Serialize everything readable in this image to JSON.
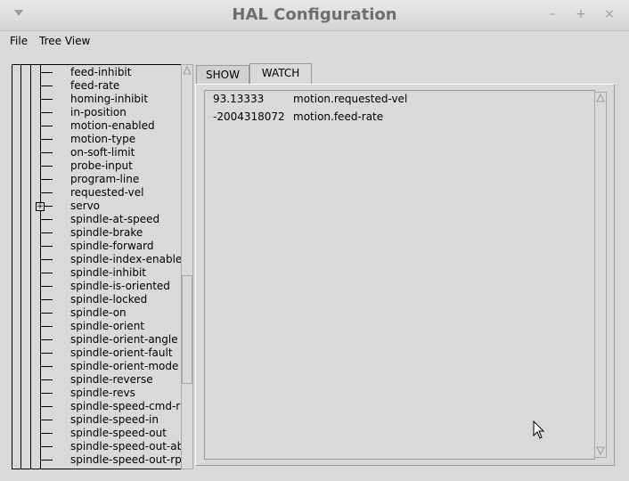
{
  "window": {
    "title": "HAL Configuration",
    "controls": {
      "minimize": "–",
      "maximize": "+",
      "close": "×"
    }
  },
  "menubar": {
    "items": [
      {
        "label": "File"
      },
      {
        "label": "Tree View"
      }
    ]
  },
  "tree": {
    "items": [
      {
        "label": "feed-inhibit",
        "expandable": false
      },
      {
        "label": "feed-rate",
        "expandable": false
      },
      {
        "label": "homing-inhibit",
        "expandable": false
      },
      {
        "label": "in-position",
        "expandable": false
      },
      {
        "label": "motion-enabled",
        "expandable": false
      },
      {
        "label": "motion-type",
        "expandable": false
      },
      {
        "label": "on-soft-limit",
        "expandable": false
      },
      {
        "label": "probe-input",
        "expandable": false
      },
      {
        "label": "program-line",
        "expandable": false
      },
      {
        "label": "requested-vel",
        "expandable": false
      },
      {
        "label": "servo",
        "expandable": true
      },
      {
        "label": "spindle-at-speed",
        "expandable": false
      },
      {
        "label": "spindle-brake",
        "expandable": false
      },
      {
        "label": "spindle-forward",
        "expandable": false
      },
      {
        "label": "spindle-index-enable",
        "expandable": false
      },
      {
        "label": "spindle-inhibit",
        "expandable": false
      },
      {
        "label": "spindle-is-oriented",
        "expandable": false
      },
      {
        "label": "spindle-locked",
        "expandable": false
      },
      {
        "label": "spindle-on",
        "expandable": false
      },
      {
        "label": "spindle-orient",
        "expandable": false
      },
      {
        "label": "spindle-orient-angle",
        "expandable": false
      },
      {
        "label": "spindle-orient-fault",
        "expandable": false
      },
      {
        "label": "spindle-orient-mode",
        "expandable": false
      },
      {
        "label": "spindle-reverse",
        "expandable": false
      },
      {
        "label": "spindle-revs",
        "expandable": false
      },
      {
        "label": "spindle-speed-cmd-r",
        "expandable": false
      },
      {
        "label": "spindle-speed-in",
        "expandable": false
      },
      {
        "label": "spindle-speed-out",
        "expandable": false
      },
      {
        "label": "spindle-speed-out-ab",
        "expandable": false
      },
      {
        "label": "spindle-speed-out-rp",
        "expandable": false
      }
    ],
    "expander_glyph": "+"
  },
  "tabs": [
    {
      "label": "SHOW",
      "active": false
    },
    {
      "label": "WATCH",
      "active": true
    }
  ],
  "watch": {
    "rows": [
      {
        "value": "93.13333",
        "name": "motion.requested-vel"
      },
      {
        "value": "-2004318072",
        "name": "motion.feed-rate"
      }
    ]
  },
  "colors": {
    "background": "#d9d9d9",
    "title_text": "#6e6e6e"
  }
}
